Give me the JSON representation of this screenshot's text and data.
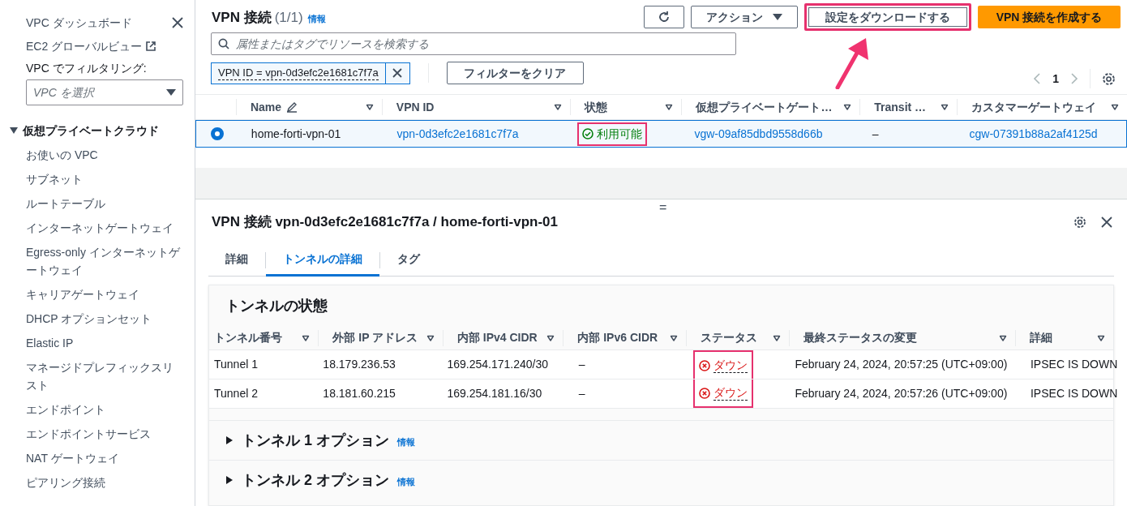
{
  "sidebar": {
    "links": [
      {
        "label": "VPC ダッシュボード",
        "kind": "plain"
      },
      {
        "label": "EC2 グローバルビュー",
        "kind": "external"
      }
    ],
    "filter_label": "VPC でフィルタリング:",
    "vpc_select": {
      "placeholder": "VPC を選択"
    },
    "section": {
      "label": "仮想プライベートクラウド",
      "expanded": true,
      "items": [
        {
          "label": "お使いの VPC"
        },
        {
          "label": "サブネット"
        },
        {
          "label": "ルートテーブル"
        },
        {
          "label": "インターネットゲートウェイ"
        },
        {
          "label": "Egress-only インターネットゲートウェイ"
        },
        {
          "label": "キャリアゲートウェイ"
        },
        {
          "label": "DHCP オプションセット"
        },
        {
          "label": "Elastic IP"
        },
        {
          "label": "マネージドプレフィックスリスト"
        },
        {
          "label": "エンドポイント"
        },
        {
          "label": "エンドポイントサービス"
        },
        {
          "label": "NAT ゲートウェイ"
        },
        {
          "label": "ピアリング接続"
        }
      ]
    }
  },
  "list": {
    "title": "VPN 接続",
    "count": "(1/1)",
    "info": "情報",
    "actions": [
      {
        "label": "アクション",
        "kind": "dropdown",
        "highlighted": false
      },
      {
        "label": "設定をダウンロードする",
        "kind": "normal",
        "highlighted": true
      },
      {
        "label": "VPN 接続を作成する",
        "kind": "primary",
        "highlighted": false
      }
    ],
    "search": {
      "placeholder": "属性またはタグでリソースを検索する"
    },
    "filter_token": "VPN ID = vpn-0d3efc2e1681c7f7a",
    "clear_filters": "フィルターをクリア",
    "page": "1",
    "columns": [
      "Name",
      "VPN ID",
      "状態",
      "仮想プライベートゲート…",
      "Transit …",
      "カスタマーゲートウェイ"
    ],
    "rows": [
      {
        "selected": true,
        "name": "home-forti-vpn-01",
        "vpn_id": "vpn-0d3efc2e1681c7f7a",
        "status": {
          "label": "利用可能",
          "kind": "available",
          "highlighted": true
        },
        "vgw": "vgw-09af85dbd9558d66b",
        "transit": "–",
        "cgw": "cgw-07391b88a2af4125d"
      }
    ]
  },
  "detail": {
    "title": "VPN 接続 vpn-0d3efc2e1681c7f7a / home-forti-vpn-01",
    "resize_handle": "=",
    "tabs": [
      {
        "label": "詳細",
        "selected": false
      },
      {
        "label": "トンネルの詳細",
        "selected": true
      },
      {
        "label": "タグ",
        "selected": false
      }
    ],
    "section_title": "トンネルの状態",
    "columns": [
      "トンネル番号",
      "外部 IP アドレス",
      "内部 IPv4 CIDR",
      "内部 IPv6 CIDR",
      "ステータス",
      "最終ステータスの変更",
      "詳細"
    ],
    "statuses_highlighted": true,
    "rows": [
      {
        "tunnel": "Tunnel 1",
        "outside_ip": "18.179.236.53",
        "ipv4": "169.254.171.240/30",
        "ipv6": "–",
        "status": {
          "label": "ダウン",
          "kind": "down"
        },
        "changed": "February 24, 2024, 20:57:25 (UTC+09:00)",
        "details": "IPSEC IS DOWN"
      },
      {
        "tunnel": "Tunnel 2",
        "outside_ip": "18.181.60.215",
        "ipv4": "169.254.181.16/30",
        "ipv6": "–",
        "status": {
          "label": "ダウン",
          "kind": "down"
        },
        "changed": "February 24, 2024, 20:57:26 (UTC+09:00)",
        "details": "IPSEC IS DOWN"
      }
    ],
    "options": [
      {
        "label": "トンネル 1 オプション",
        "info": "情報",
        "expanded": false
      },
      {
        "label": "トンネル 2 オプション",
        "info": "情報",
        "expanded": false
      }
    ]
  }
}
